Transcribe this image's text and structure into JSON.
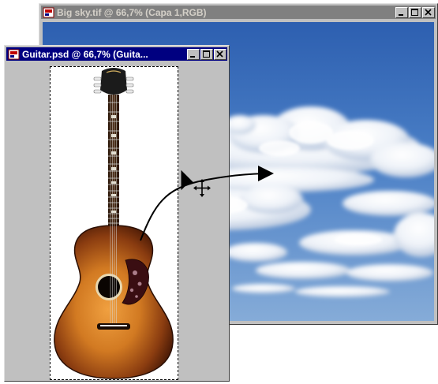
{
  "sky_window": {
    "title": "Big sky.tif @ 66,7% (Capa 1,RGB)",
    "active": false
  },
  "guitar_window": {
    "title": "Guitar.psd @ 66,7% (Guita...",
    "active": true
  },
  "window_controls": [
    "minimize-icon",
    "maximize-icon",
    "close-icon"
  ],
  "cursor": "move-tool-cursor",
  "colors": {
    "title_active": "#000080",
    "title_inactive": "#808080",
    "sky_top": "#2f62b3",
    "sky_bottom": "#7ba4d6",
    "guitar_body_center": "#e08a2a",
    "guitar_body_edge": "#5a2208"
  }
}
